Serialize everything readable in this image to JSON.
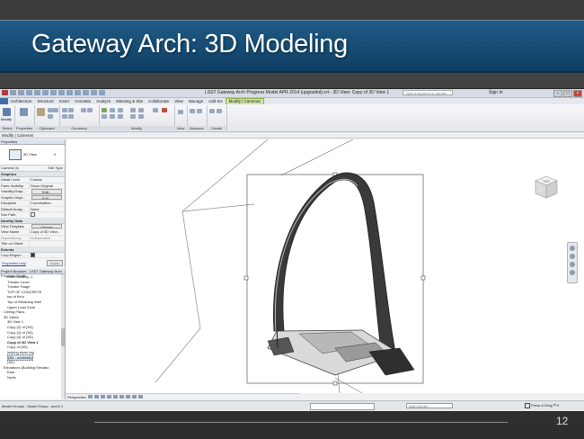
{
  "slide": {
    "title": "Gateway Arch: 3D Modeling",
    "page_number": "12"
  },
  "revit": {
    "window_title": "LSST Gateway Arch Progress Model APR 2014 (upgraded).rvt - 3D View: Copy of 3D View 1",
    "search_placeholder": "Type a keyword or phrase",
    "sign_in": "Sign In",
    "ribbon_tabs": [
      "Architecture",
      "Structure",
      "Insert",
      "Annotate",
      "Analyze",
      "Massing & Site",
      "Collaborate",
      "View",
      "Manage",
      "Add-Ins",
      "Modify | Cameras"
    ],
    "file_tab": "",
    "active_tab": "Modify | Cameras",
    "panels": {
      "select": "Select",
      "properties": "Properties",
      "clipboard": "Clipboard",
      "geometry": "Geometry",
      "modify": "Modify",
      "view": "View",
      "measure": "Measure",
      "create": "Create",
      "modify_tool": "Modify"
    },
    "options_bar": "Modify | Cameras",
    "properties_palette": {
      "header": "Properties",
      "type_name": "3D View",
      "filter": "Camera (1)",
      "edit_type": "Edit Type",
      "sections": {
        "graphics": "Graphics",
        "identity": "Identity Data",
        "extents": "Extents"
      },
      "graphics_rows": [
        {
          "k": "Detail Level",
          "v": "Coarse"
        },
        {
          "k": "Parts Visibility",
          "v": "Show Original"
        },
        {
          "k": "Visibility/Grap...",
          "v": "Edit..."
        },
        {
          "k": "Graphic Displ...",
          "v": "Edit..."
        },
        {
          "k": "Discipline",
          "v": "Coordination"
        },
        {
          "k": "Default Analy...",
          "v": "None"
        },
        {
          "k": "Sun Path",
          "v": ""
        }
      ],
      "identity_rows": [
        {
          "k": "View Template",
          "v": "<None>"
        },
        {
          "k": "View Name",
          "v": "Copy of 3D View..."
        },
        {
          "k": "Dependency",
          "v": "Independent"
        },
        {
          "k": "Title on Sheet",
          "v": ""
        }
      ],
      "extents_rows": [
        {
          "k": "Crop Region ...",
          "v": ""
        }
      ],
      "help_link": "Properties help",
      "apply": "Apply"
    },
    "project_browser": {
      "header": "Project Browser - LSST Gateway Arch Progress Model",
      "items": [
        {
          "label": "Stair Landing -1",
          "indent": 4,
          "style": "normal"
        },
        {
          "label": "Theater Level",
          "indent": 4,
          "style": "normal"
        },
        {
          "label": "Theater Stage",
          "indent": 4,
          "style": "normal"
        },
        {
          "label": "TOP OF CONCRETE",
          "indent": 4,
          "style": "normal"
        },
        {
          "label": "top of floor",
          "indent": 4,
          "style": "normal"
        },
        {
          "label": "Top of Retaining Wall",
          "indent": 4,
          "style": "normal"
        },
        {
          "label": "Upper Load Zone",
          "indent": 4,
          "style": "normal"
        },
        {
          "label": "Ceiling Plans",
          "indent": 2,
          "style": "normal"
        },
        {
          "label": "3D Views",
          "indent": 2,
          "style": "normal"
        },
        {
          "label": "3D View 1",
          "indent": 4,
          "style": "normal"
        },
        {
          "label": "Copy (2) of {3D}",
          "indent": 4,
          "style": "normal"
        },
        {
          "label": "Copy (3) of {3D}",
          "indent": 4,
          "style": "normal"
        },
        {
          "label": "Copy (4) of {3D}",
          "indent": 4,
          "style": "normal"
        },
        {
          "label": "Copy of 3D View 1",
          "indent": 4,
          "style": "bold"
        },
        {
          "label": "Copy of {3D}",
          "indent": 4,
          "style": "normal"
        },
        {
          "label": "looking down leg",
          "indent": 4,
          "style": "normal"
        },
        {
          "label": "{3D - andrewb}",
          "indent": 4,
          "style": "selected"
        },
        {
          "label": "{3D}",
          "indent": 4,
          "style": "normal"
        },
        {
          "label": "Elevations (Building Elevatio",
          "indent": 2,
          "style": "normal"
        },
        {
          "label": "East",
          "indent": 4,
          "style": "normal"
        },
        {
          "label": "North",
          "indent": 4,
          "style": "normal"
        }
      ]
    },
    "view_control_label": "Perspective",
    "status_bar": {
      "left": "Model Groups : Model Group : arch2.1",
      "main_model": "Main Model",
      "press_drag": "Press & Drag",
      "filter_count": ":0"
    },
    "viewcube_label": "TOP"
  }
}
